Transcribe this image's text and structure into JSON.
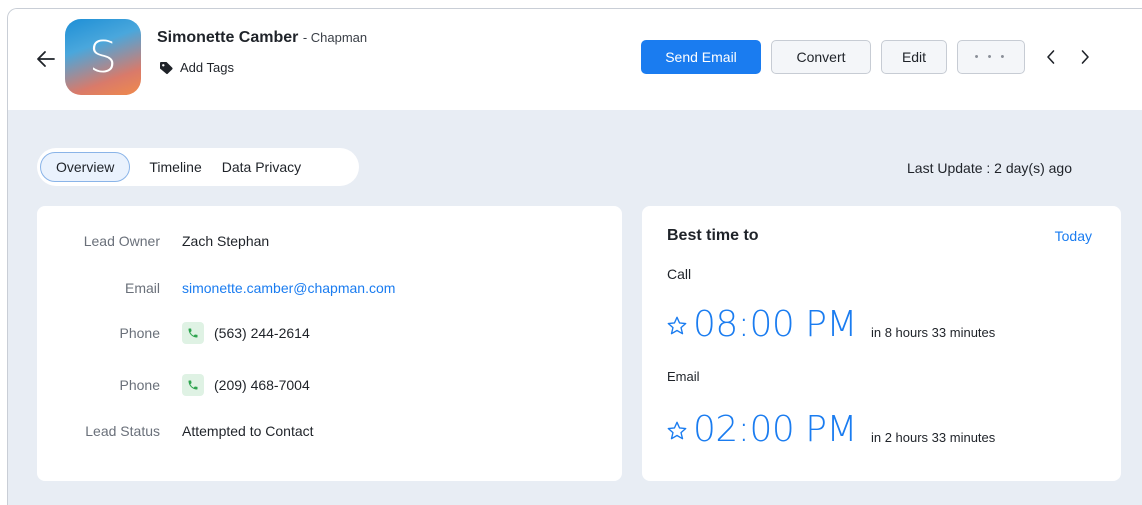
{
  "header": {
    "avatar_letter": "S",
    "name": "Simonette Camber",
    "company": "- Chapman",
    "add_tags": "Add Tags",
    "buttons": {
      "send_email": "Send Email",
      "convert": "Convert",
      "edit": "Edit",
      "more": "• • •"
    },
    "icons": {
      "back": "arrow-left-icon",
      "tag": "tag-icon",
      "prev": "chevron-left-icon",
      "next": "chevron-right-icon"
    }
  },
  "tabs": [
    {
      "label": "Overview",
      "active": true
    },
    {
      "label": "Timeline",
      "active": false
    },
    {
      "label": "Data Privacy",
      "active": false
    }
  ],
  "last_update": "Last Update : 2 day(s) ago",
  "details": [
    {
      "label": "Lead Owner",
      "value": "Zach Stephan"
    },
    {
      "label": "Email",
      "value": "simonette.camber@chapman.com"
    },
    {
      "label": "Phone",
      "value": "(563) 244-2614"
    },
    {
      "label": "Phone",
      "value": "(209) 468-7004"
    },
    {
      "label": "Lead Status",
      "value": "Attempted to Contact"
    }
  ],
  "best_time": {
    "title": "Best time to",
    "today": "Today",
    "call_label": "Call",
    "call_time": "08:00 PM",
    "call_relative": "in 8 hours 33 minutes",
    "email_label": "Email",
    "email_time": "02:00 PM",
    "email_relative": "in 2 hours 33 minutes"
  },
  "colors": {
    "accent": "#1a7cf0",
    "background": "#e8edf4",
    "phone_icon_bg": "#dff2e4",
    "phone_icon": "#2ea44f"
  }
}
